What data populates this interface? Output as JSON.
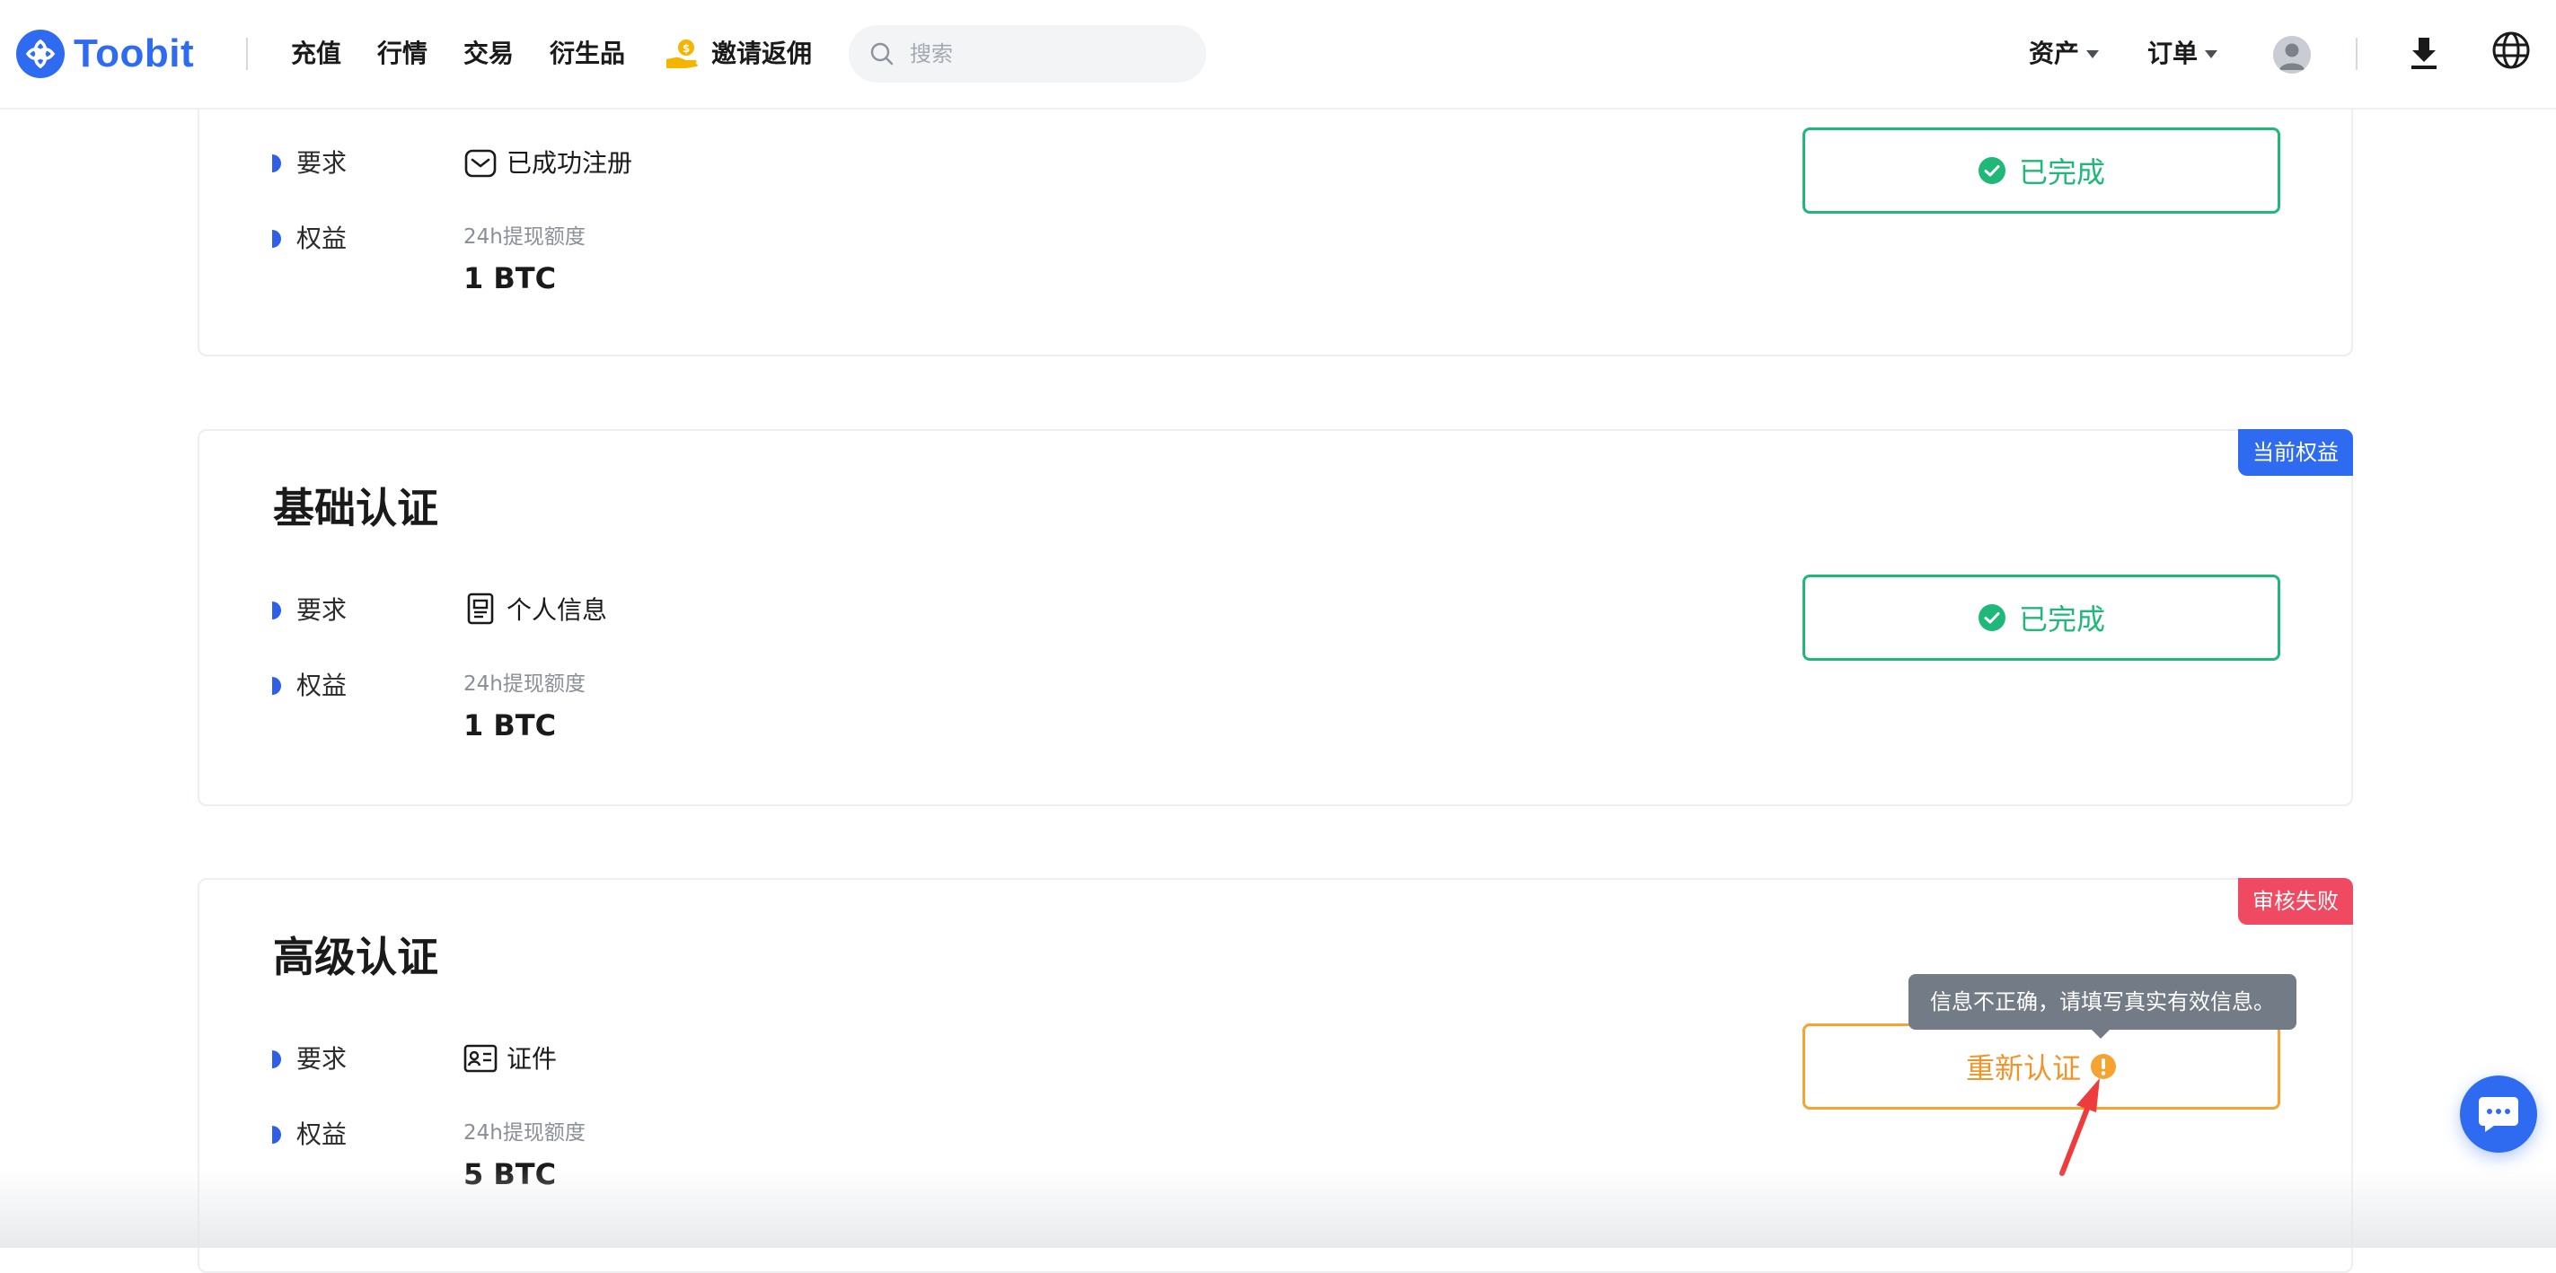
{
  "header": {
    "logo_text": "Toobit",
    "nav": [
      "充值",
      "行情",
      "交易",
      "衍生品"
    ],
    "promo_label": "邀请返佣",
    "search_placeholder": "搜索",
    "assets_label": "资产",
    "orders_label": "订单"
  },
  "cards": [
    {
      "title": "",
      "requirement_label": "要求",
      "requirement_icon": "envelope-icon",
      "requirement_text": "已成功注册",
      "benefit_label": "权益",
      "benefit_caption": "24h提现额度",
      "benefit_value": "1 BTC",
      "status_label": "已完成",
      "status": "done"
    },
    {
      "title": "基础认证",
      "badge": "当前权益",
      "requirement_label": "要求",
      "requirement_icon": "document-icon",
      "requirement_text": "个人信息",
      "benefit_label": "权益",
      "benefit_caption": "24h提现额度",
      "benefit_value": "1 BTC",
      "status_label": "已完成",
      "status": "done"
    },
    {
      "title": "高级认证",
      "badge": "审核失败",
      "requirement_label": "要求",
      "requirement_icon": "id-card-icon",
      "requirement_text": "证件",
      "benefit_label": "权益",
      "benefit_caption": "24h提现额度",
      "benefit_value": "5 BTC",
      "status_label": "重新认证",
      "status": "retry"
    }
  ],
  "tooltip": {
    "text": "信息不正确，请填写真实有效信息。"
  },
  "colors": {
    "brand": "#2f6bf0",
    "success": "#1fb879",
    "warning": "#f0952a",
    "danger": "#f04a63",
    "tooltip_bg": "#737b86"
  }
}
